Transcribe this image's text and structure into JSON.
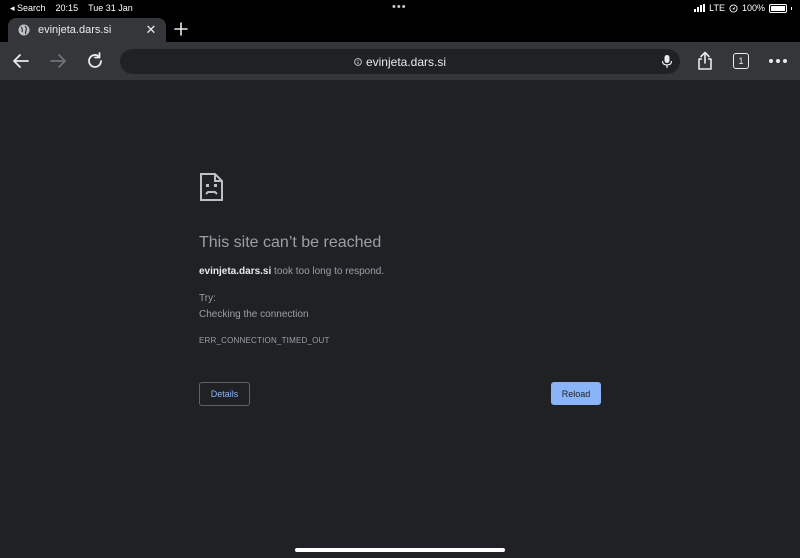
{
  "status_bar": {
    "back_app": "◂ Search",
    "time": "20:15",
    "date": "Tue 31 Jan",
    "network": "LTE",
    "battery": "100%"
  },
  "tab": {
    "title": "evinjeta.dars.si"
  },
  "omnibox": {
    "url": "evinjeta.dars.si"
  },
  "toolbar": {
    "tab_count": "1"
  },
  "error": {
    "title": "This site can’t be reached",
    "host": "evinjeta.dars.si",
    "message": " took too long to respond.",
    "try_label": "Try:",
    "suggestion": "Checking the connection",
    "code": "ERR_CONNECTION_TIMED_OUT",
    "details_label": "Details",
    "reload_label": "Reload"
  },
  "colors": {
    "background": "#202124",
    "toolbar": "#35363a",
    "accent": "#8ab4f8",
    "text_muted": "#9aa0a6"
  },
  "icons": [
    "globe-icon",
    "close-icon",
    "plus-icon",
    "back-arrow-icon",
    "forward-arrow-icon",
    "reload-icon",
    "info-icon",
    "microphone-icon",
    "share-icon",
    "more-icon",
    "sad-document-icon"
  ]
}
